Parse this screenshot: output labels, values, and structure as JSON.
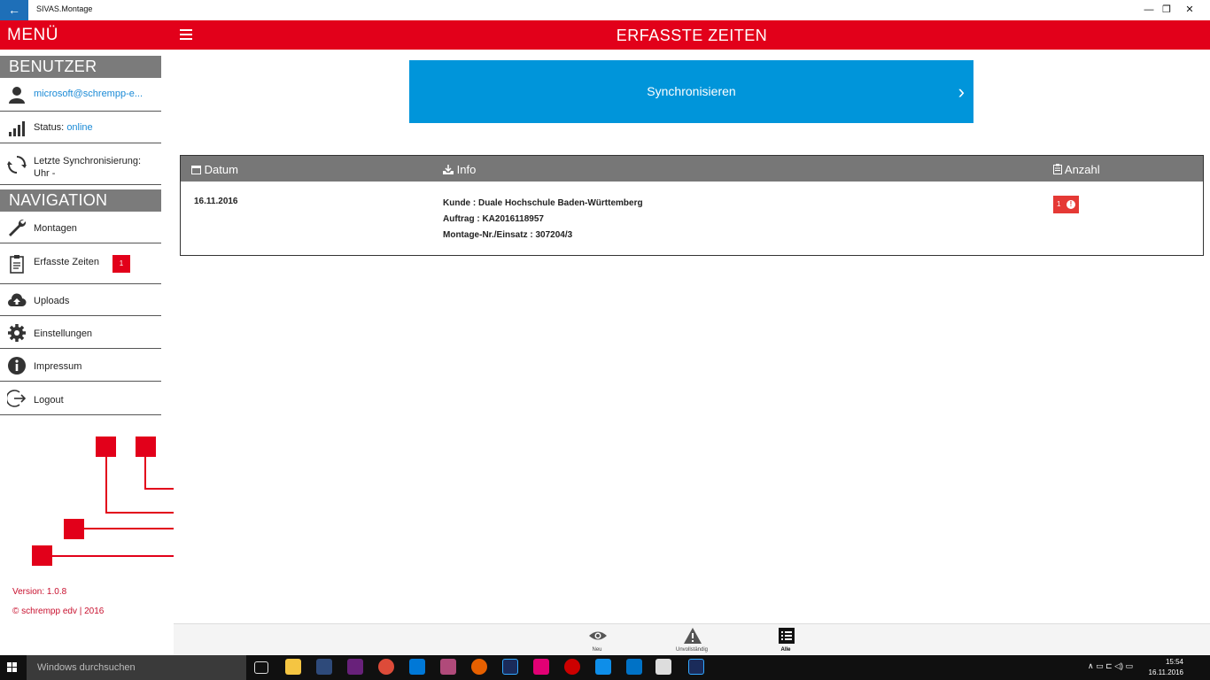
{
  "window": {
    "title": "SIVAS.Montage",
    "back_glyph": "←",
    "minimize_glyph": "—",
    "maximize_glyph": "❐",
    "close_glyph": "✕"
  },
  "header": {
    "menu_title": "MENÜ",
    "page_title": "ERFASSTE ZEITEN"
  },
  "sidebar": {
    "benutzer_heading": "BENUTZER",
    "user_email": "microsoft@schrempp-e...",
    "status_label": "Status:",
    "status_value": "online",
    "sync_label": "Letzte Synchronisierung:",
    "sync_value": "Uhr -",
    "navigation_heading": "NAVIGATION",
    "items": [
      {
        "label": "Montagen",
        "icon": "wrench-icon"
      },
      {
        "label": "Erfasste Zeiten",
        "icon": "clipboard-icon",
        "badge": "1"
      },
      {
        "label": "Uploads",
        "icon": "cloud-upload-icon"
      },
      {
        "label": "Einstellungen",
        "icon": "gear-icon"
      },
      {
        "label": "Impressum",
        "icon": "info-icon"
      },
      {
        "label": "Logout",
        "icon": "logout-icon"
      }
    ],
    "version": "Version: 1.0.8",
    "copyright": "© schrempp edv | 2016"
  },
  "main": {
    "sync_button": "Synchronisieren",
    "table": {
      "headers": {
        "datum": "Datum",
        "info": "Info",
        "anzahl": "Anzahl"
      },
      "rows": [
        {
          "datum": "16.11.2016",
          "kunde": "Kunde : Duale Hochschule Baden-Württemberg",
          "auftrag": "Auftrag : KA2016118957",
          "montage": "Montage-Nr./Einsatz : 307204/3",
          "anzahl": "1",
          "anzahl_icon": "!"
        }
      ]
    }
  },
  "appbar": {
    "neu": "Neu",
    "unvollstaendig": "Unvollständig",
    "alle": "Alle"
  },
  "taskbar": {
    "search_placeholder": "Windows durchsuchen",
    "time": "15:54",
    "date": "16.11.2016"
  },
  "colors": {
    "brand_red": "#e2001a",
    "sync_blue": "#0095da",
    "section_gray": "#7b7b7b"
  }
}
